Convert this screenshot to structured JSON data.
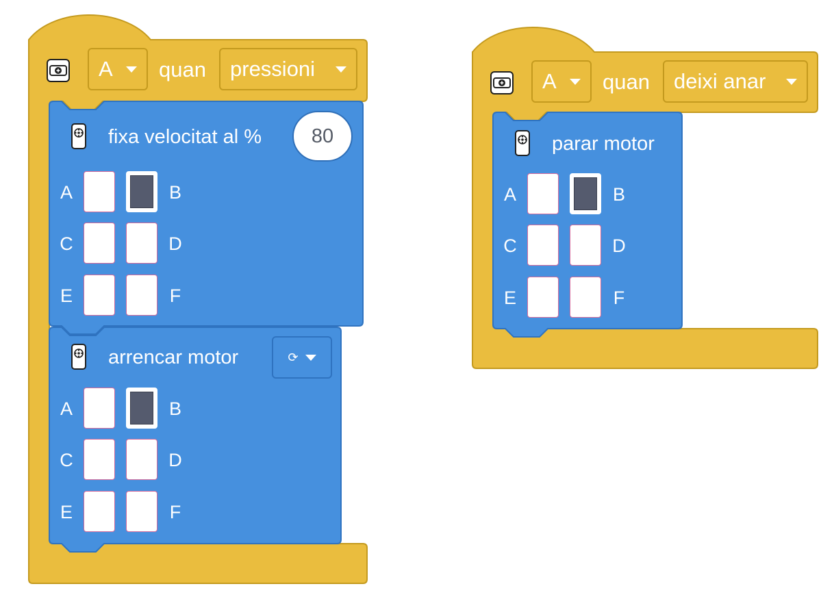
{
  "colors": {
    "event_block": "#eabd3e",
    "event_block_border": "#c49a1e",
    "action_block": "#4690de",
    "action_block_border": "#2f73c0",
    "port_selected": "#555b6e",
    "port_empty": "#ffffff"
  },
  "event1": {
    "icon": "hub-icon",
    "button_value": "A",
    "when_label": "quan",
    "action_value": "pressioni",
    "blocks": [
      {
        "icon": "motor-icon",
        "title": "fixa velocitat al %",
        "value": "80",
        "ports": {
          "A": "A",
          "B": "B",
          "C": "C",
          "D": "D",
          "E": "E",
          "F": "F"
        },
        "selected_ports": [
          "B"
        ]
      },
      {
        "icon": "motor-icon",
        "title": "arrencar motor",
        "direction_symbol": "⟳",
        "ports": {
          "A": "A",
          "B": "B",
          "C": "C",
          "D": "D",
          "E": "E",
          "F": "F"
        },
        "selected_ports": [
          "B"
        ]
      }
    ]
  },
  "event2": {
    "icon": "hub-icon",
    "button_value": "A",
    "when_label": "quan",
    "action_value": "deixi anar",
    "blocks": [
      {
        "icon": "motor-icon",
        "title": "parar motor",
        "ports": {
          "A": "A",
          "B": "B",
          "C": "C",
          "D": "D",
          "E": "E",
          "F": "F"
        },
        "selected_ports": [
          "B"
        ]
      }
    ]
  }
}
